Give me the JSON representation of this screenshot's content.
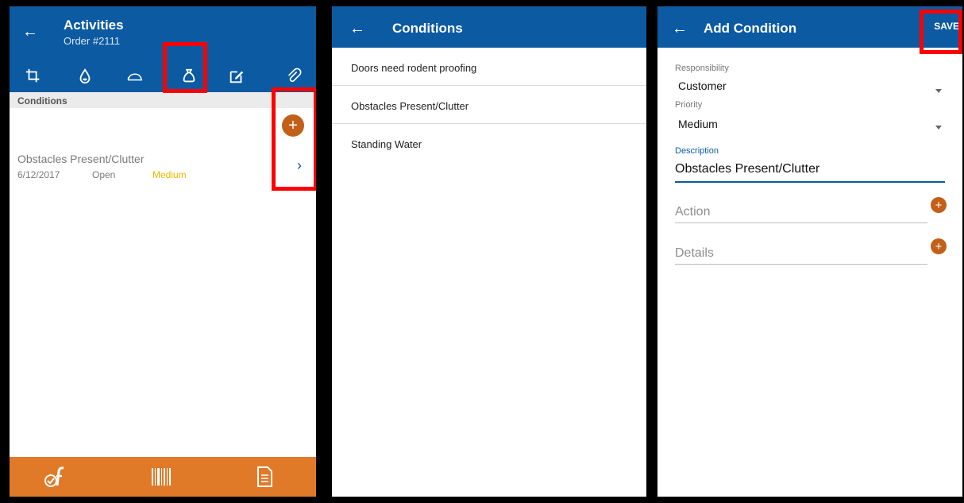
{
  "panel_activities": {
    "title": "Activities",
    "subtitle": "Order #2111",
    "tabs": [
      {
        "icon": "crop-icon"
      },
      {
        "icon": "water-drop-icon"
      },
      {
        "icon": "rodent-icon"
      },
      {
        "icon": "bag-icon",
        "active": true
      },
      {
        "icon": "edit-icon"
      },
      {
        "icon": "paperclip-icon"
      }
    ],
    "section_label": "Conditions",
    "add_button": "+",
    "item": {
      "title": "Obstacles Present/Clutter",
      "date": "6/12/2017",
      "status": "Open",
      "priority": "Medium"
    },
    "bottom_icons": [
      "service-icon",
      "barcode-icon",
      "document-icon"
    ]
  },
  "panel_conditions": {
    "title": "Conditions",
    "items": [
      "Doors need rodent proofing",
      "Obstacles Present/Clutter",
      "Standing Water"
    ]
  },
  "panel_add_condition": {
    "title": "Add Condition",
    "save_label": "SAVE",
    "responsibility_label": "Responsibility",
    "responsibility_value": "Customer",
    "priority_label": "Priority",
    "priority_value": "Medium",
    "description_label": "Description",
    "description_value": "Obstacles Present/Clutter",
    "action_placeholder": "Action",
    "details_placeholder": "Details"
  },
  "colors": {
    "header_blue": "#0b5aa2",
    "accent_orange": "#e07a28",
    "fab_brown": "#c2601a",
    "priority_yellow": "#e6b800",
    "highlight_red": "#ff0000"
  }
}
